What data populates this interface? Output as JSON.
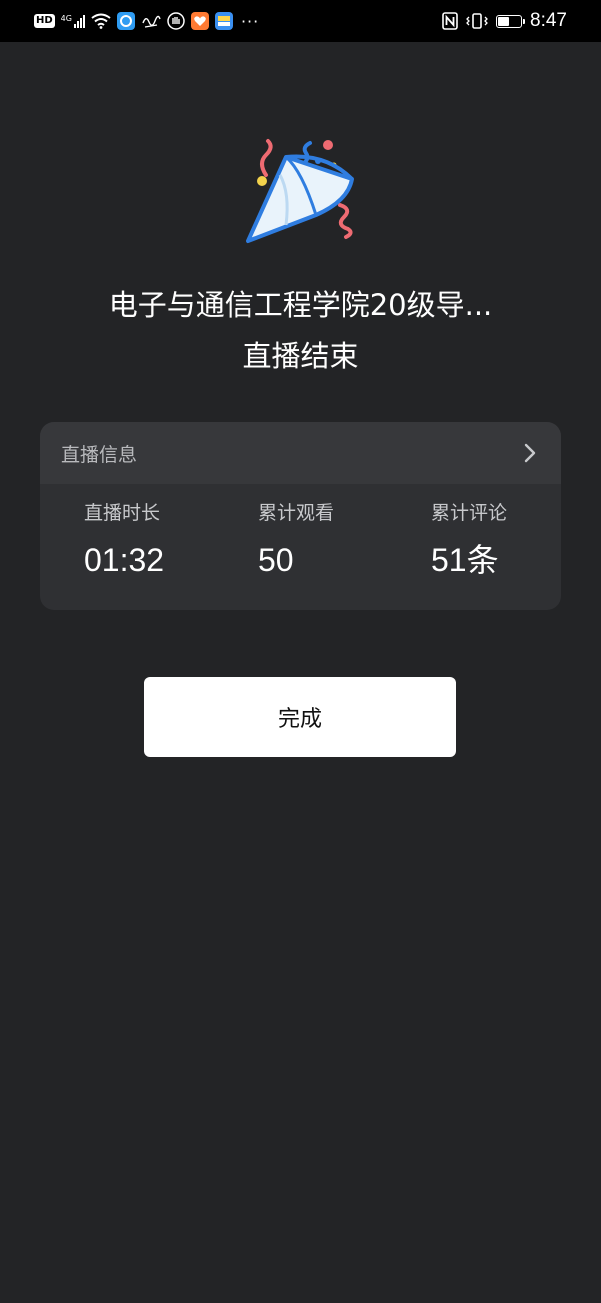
{
  "status_bar": {
    "hd_label": "HD",
    "network_label": "4G",
    "overflow_dots": "···",
    "nfc_label": "N",
    "time": "8:47",
    "battery_level": 0.45
  },
  "hero": {
    "icon": "party-popper-icon",
    "title": "电子与通信工程学院20级导...",
    "subtitle": "直播结束"
  },
  "info_card": {
    "header_title": "直播信息",
    "stats": [
      {
        "label": "直播时长",
        "value": "01:32"
      },
      {
        "label": "累计观看",
        "value": "50"
      },
      {
        "label": "累计评论",
        "value": "51条"
      }
    ]
  },
  "done_button": {
    "label": "完成"
  },
  "colors": {
    "background": "#232426",
    "card": "#2f3033",
    "card_header": "#37383b",
    "button": "#ffffff"
  }
}
